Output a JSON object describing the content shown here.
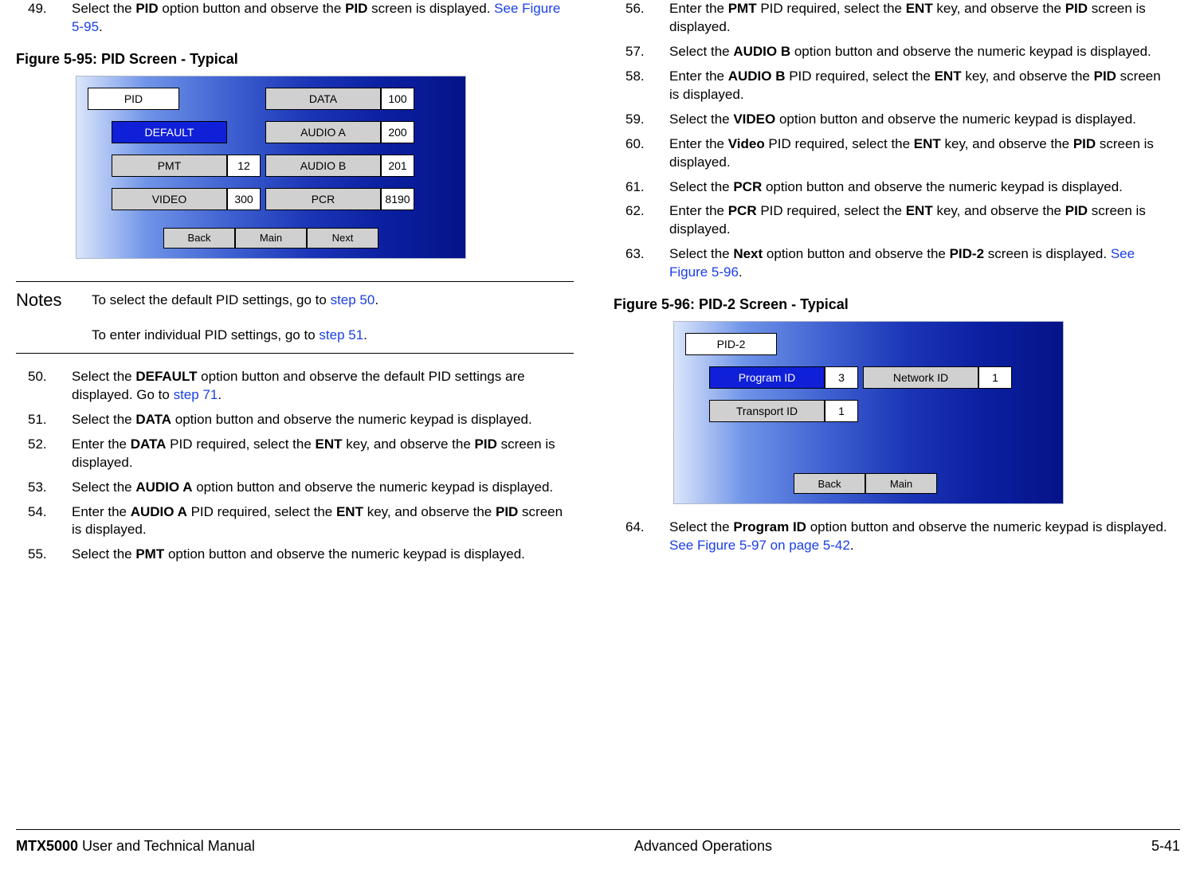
{
  "left": {
    "steps_top": [
      {
        "num": "49.",
        "html": "Select the <b>PID</b> option button and observe the <b>PID</b> screen is displayed.  <span class='link'>See Figure 5-95</span>."
      }
    ],
    "fig95_caption": "Figure 5-95:   PID Screen - Typical",
    "fig95": {
      "r1": {
        "hdr": "PID",
        "btn2": "DATA",
        "v2": "100"
      },
      "r2": {
        "btn1": "DEFAULT",
        "btn2": "AUDIO A",
        "v2": "200"
      },
      "r3": {
        "btn1": "PMT",
        "v1": "12",
        "btn2": "AUDIO B",
        "v2": "201"
      },
      "r4": {
        "btn1": "VIDEO",
        "v1": "300",
        "btn2": "PCR",
        "v2": "8190"
      },
      "nav": {
        "back": "Back",
        "main": "Main",
        "next": "Next"
      }
    },
    "notes_title": "Notes",
    "notes": [
      "To select the default PID settings, go to <span class='link'>step 50</span>.",
      "To enter individual PID settings, go to <span class='link'>step 51</span>."
    ],
    "steps_bottom": [
      {
        "num": "50.",
        "html": "Select the <b>DEFAULT</b> option button and observe the default PID settings are displayed.  Go to <span class='link'>step 71</span>."
      },
      {
        "num": "51.",
        "html": "Select the <b>DATA</b> option button and observe the numeric keypad is displayed."
      },
      {
        "num": "52.",
        "html": "Enter the <b>DATA</b> PID required, select the <b>ENT</b> key, and observe the <b>PID</b> screen is displayed."
      },
      {
        "num": "53.",
        "html": "Select the <b>AUDIO A</b> option button and observe the numeric keypad is displayed."
      },
      {
        "num": "54.",
        "html": "Enter the <b>AUDIO A</b> PID required, select the <b>ENT</b> key, and observe the <b>PID</b> screen is displayed."
      },
      {
        "num": "55.",
        "html": "Select the <b>PMT</b> option button and observe the numeric keypad is displayed."
      }
    ]
  },
  "right": {
    "steps_top": [
      {
        "num": "56.",
        "html": "Enter the <b>PMT</b> PID required, select the <b>ENT</b> key, and observe the <b>PID</b> screen is displayed."
      },
      {
        "num": "57.",
        "html": "Select the <b>AUDIO B</b> option button and observe the numeric keypad is displayed."
      },
      {
        "num": "58.",
        "html": "Enter the <b>AUDIO B</b> PID required, select the <b>ENT</b> key, and observe the <b>PID</b> screen is displayed."
      },
      {
        "num": "59.",
        "html": "Select the <b>VIDEO</b> option button and observe the numeric keypad is displayed."
      },
      {
        "num": "60.",
        "html": "Enter the <b>Video</b> PID required, select the <b>ENT</b> key, and observe the <b>PID</b> screen is displayed."
      },
      {
        "num": "61.",
        "html": "Select the <b>PCR</b> option button and observe the numeric keypad is displayed."
      },
      {
        "num": "62.",
        "html": "Enter the <b>PCR</b> PID required, select the <b>ENT</b> key, and observe the <b>PID</b> screen is displayed."
      },
      {
        "num": "63.",
        "html": "Select the <b>Next</b> option button and observe the <b>PID-2</b> screen is displayed.  <span class='link'>See Figure 5-96</span>."
      }
    ],
    "fig96_caption": "Figure 5-96:   PID-2 Screen - Typical",
    "fig96": {
      "hdr": "PID-2",
      "r1": {
        "btn1": "Program ID",
        "v1": "3",
        "btn2": "Network ID",
        "v2": "1"
      },
      "r2": {
        "btn1": "Transport ID",
        "v1": "1"
      },
      "nav": {
        "back": "Back",
        "main": "Main"
      }
    },
    "steps_bottom": [
      {
        "num": "64.",
        "html": "Select the <b>Program ID</b> option button and observe the numeric keypad is displayed.  <span class='link'>See Figure 5-97 on page 5-42</span>."
      }
    ]
  },
  "footer": {
    "left_bold": "MTX5000",
    "left_rest": " User and Technical Manual",
    "center": "Advanced Operations",
    "right": "5-41"
  }
}
